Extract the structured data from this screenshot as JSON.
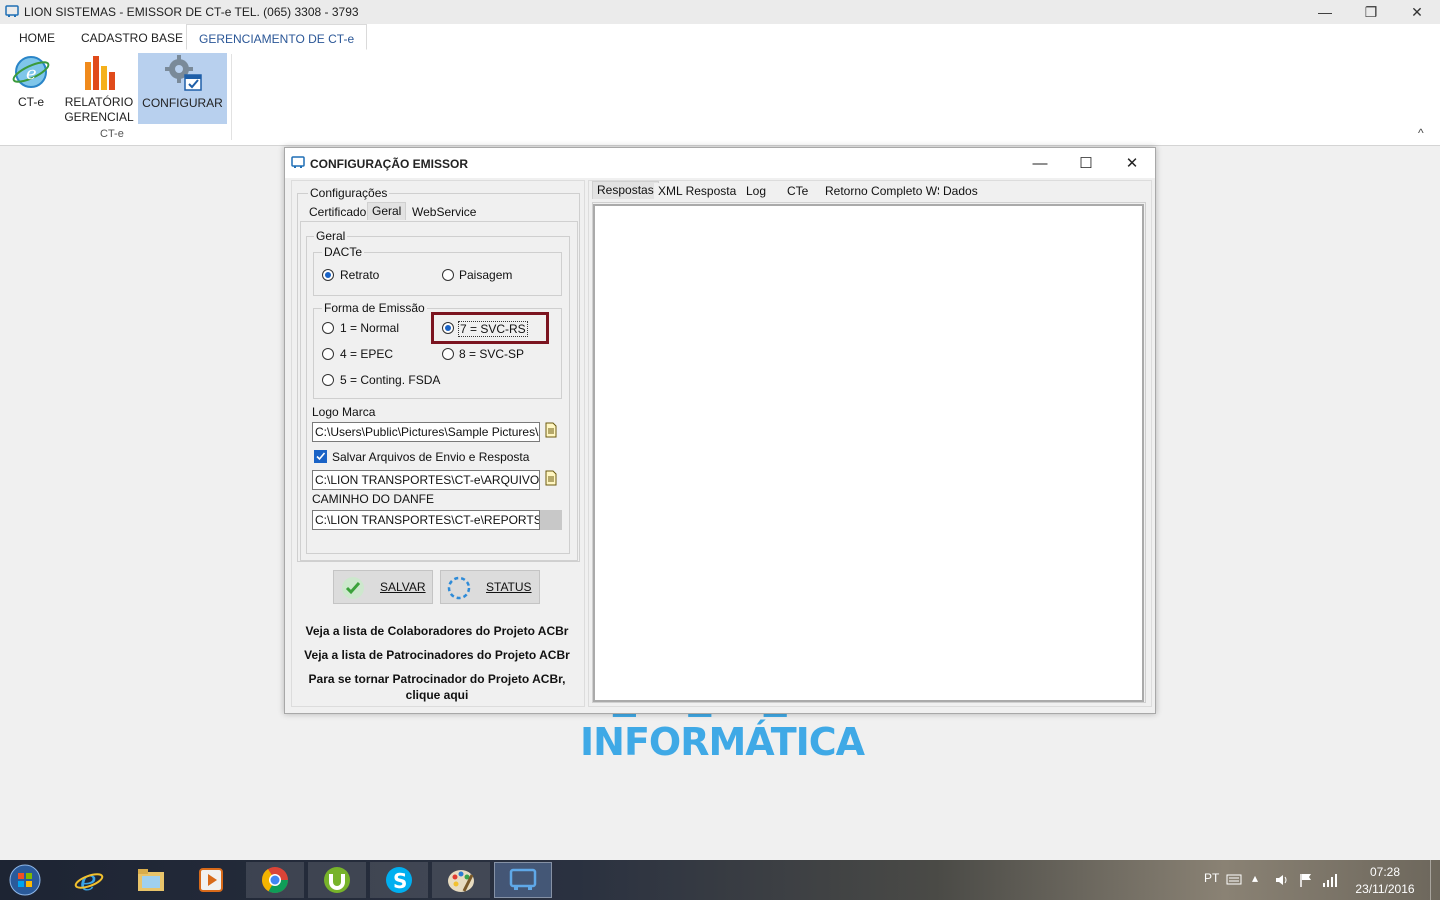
{
  "window": {
    "title": "LION SISTEMAS - EMISSOR DE CT-e  TEL. (065) 3308 - 3793",
    "minimize": "—",
    "restore": "❐",
    "close": "✕"
  },
  "ribbon": {
    "tabs": [
      "HOME",
      "CADASTRO BASE",
      "GERENCIAMENTO DE CT-e"
    ],
    "buttons": {
      "cte": "CT-e",
      "relatorio1": "RELATÓRIO",
      "relatorio2": "GERENCIAL",
      "configurar": "CONFIGURAR"
    },
    "group_label": "CT-e",
    "collapse": "^"
  },
  "background_logo": "INFORMÁTICA",
  "dialog": {
    "title": "CONFIGURAÇÃO EMISSOR",
    "controls": {
      "min": "—",
      "max": "☐",
      "close": "✕"
    },
    "config_group": "Configurações",
    "left_tabs": [
      "Certificado",
      "Geral",
      "WebService"
    ],
    "geral_group": "Geral",
    "dacte_group": "DACTe",
    "dacte_options": {
      "retrato": "Retrato",
      "paisagem": "Paisagem"
    },
    "forma_group": "Forma de Emissão",
    "forma_options": {
      "normal": "1 = Normal",
      "svcrs": "7 = SVC-RS",
      "epec": "4 = EPEC",
      "svcsp": "8 = SVC-SP",
      "fsda": "5 = Conting. FSDA"
    },
    "logo_label": "Logo Marca",
    "logo_value": "C:\\Users\\Public\\Pictures\\Sample Pictures\\Koala.jpg",
    "salvar_arquivos_label": "Salvar Arquivos de Envio e Resposta",
    "arquivos_value": "C:\\LION TRANSPORTES\\CT-e\\ARQUIVOS",
    "danfe_label": "CAMINHO DO DANFE",
    "danfe_value": "C:\\LION TRANSPORTES\\CT-e\\REPORTS\\DACTE",
    "salvar_button": "SALVAR",
    "status_button": "STATUS",
    "link_colaboradores": "Veja a lista de Colaboradores do Projeto ACBr",
    "link_patrocinadores": "Veja a lista de Patrocinadores do Projeto ACBr",
    "link_patrocinador1": "Para se tornar Patrocinador do Projeto ACBr,",
    "link_patrocinador2": "clique aqui",
    "right_tabs": [
      "Respostas",
      "XML Resposta",
      "Log",
      "CTe",
      "Retorno Completo WS",
      "Dados"
    ]
  },
  "taskbar": {
    "lang": "PT",
    "time": "07:28",
    "date": "23/11/2016"
  },
  "colors": {
    "ribbon_active": "#2b5797",
    "highlight_box": "#7b1420",
    "logo_blue": "#3fa9e6",
    "radio_dot": "#1a63c6"
  }
}
